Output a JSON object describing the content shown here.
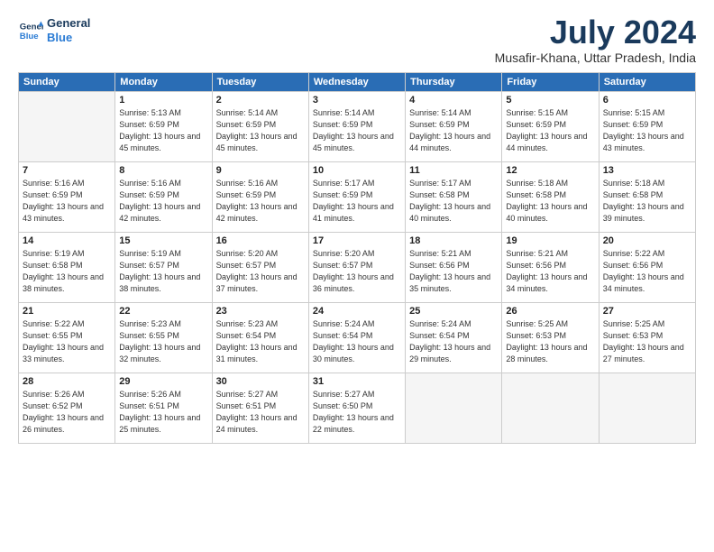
{
  "header": {
    "logo_line1": "General",
    "logo_line2": "Blue",
    "month_year": "July 2024",
    "location": "Musafir-Khana, Uttar Pradesh, India"
  },
  "weekdays": [
    "Sunday",
    "Monday",
    "Tuesday",
    "Wednesday",
    "Thursday",
    "Friday",
    "Saturday"
  ],
  "weeks": [
    [
      {
        "day": "",
        "empty": true
      },
      {
        "day": "1",
        "sunrise": "5:13 AM",
        "sunset": "6:59 PM",
        "daylight": "13 hours and 45 minutes."
      },
      {
        "day": "2",
        "sunrise": "5:14 AM",
        "sunset": "6:59 PM",
        "daylight": "13 hours and 45 minutes."
      },
      {
        "day": "3",
        "sunrise": "5:14 AM",
        "sunset": "6:59 PM",
        "daylight": "13 hours and 45 minutes."
      },
      {
        "day": "4",
        "sunrise": "5:14 AM",
        "sunset": "6:59 PM",
        "daylight": "13 hours and 44 minutes."
      },
      {
        "day": "5",
        "sunrise": "5:15 AM",
        "sunset": "6:59 PM",
        "daylight": "13 hours and 44 minutes."
      },
      {
        "day": "6",
        "sunrise": "5:15 AM",
        "sunset": "6:59 PM",
        "daylight": "13 hours and 43 minutes."
      }
    ],
    [
      {
        "day": "7",
        "sunrise": "5:16 AM",
        "sunset": "6:59 PM",
        "daylight": "13 hours and 43 minutes."
      },
      {
        "day": "8",
        "sunrise": "5:16 AM",
        "sunset": "6:59 PM",
        "daylight": "13 hours and 42 minutes."
      },
      {
        "day": "9",
        "sunrise": "5:16 AM",
        "sunset": "6:59 PM",
        "daylight": "13 hours and 42 minutes."
      },
      {
        "day": "10",
        "sunrise": "5:17 AM",
        "sunset": "6:59 PM",
        "daylight": "13 hours and 41 minutes."
      },
      {
        "day": "11",
        "sunrise": "5:17 AM",
        "sunset": "6:58 PM",
        "daylight": "13 hours and 40 minutes."
      },
      {
        "day": "12",
        "sunrise": "5:18 AM",
        "sunset": "6:58 PM",
        "daylight": "13 hours and 40 minutes."
      },
      {
        "day": "13",
        "sunrise": "5:18 AM",
        "sunset": "6:58 PM",
        "daylight": "13 hours and 39 minutes."
      }
    ],
    [
      {
        "day": "14",
        "sunrise": "5:19 AM",
        "sunset": "6:58 PM",
        "daylight": "13 hours and 38 minutes."
      },
      {
        "day": "15",
        "sunrise": "5:19 AM",
        "sunset": "6:57 PM",
        "daylight": "13 hours and 38 minutes."
      },
      {
        "day": "16",
        "sunrise": "5:20 AM",
        "sunset": "6:57 PM",
        "daylight": "13 hours and 37 minutes."
      },
      {
        "day": "17",
        "sunrise": "5:20 AM",
        "sunset": "6:57 PM",
        "daylight": "13 hours and 36 minutes."
      },
      {
        "day": "18",
        "sunrise": "5:21 AM",
        "sunset": "6:56 PM",
        "daylight": "13 hours and 35 minutes."
      },
      {
        "day": "19",
        "sunrise": "5:21 AM",
        "sunset": "6:56 PM",
        "daylight": "13 hours and 34 minutes."
      },
      {
        "day": "20",
        "sunrise": "5:22 AM",
        "sunset": "6:56 PM",
        "daylight": "13 hours and 34 minutes."
      }
    ],
    [
      {
        "day": "21",
        "sunrise": "5:22 AM",
        "sunset": "6:55 PM",
        "daylight": "13 hours and 33 minutes."
      },
      {
        "day": "22",
        "sunrise": "5:23 AM",
        "sunset": "6:55 PM",
        "daylight": "13 hours and 32 minutes."
      },
      {
        "day": "23",
        "sunrise": "5:23 AM",
        "sunset": "6:54 PM",
        "daylight": "13 hours and 31 minutes."
      },
      {
        "day": "24",
        "sunrise": "5:24 AM",
        "sunset": "6:54 PM",
        "daylight": "13 hours and 30 minutes."
      },
      {
        "day": "25",
        "sunrise": "5:24 AM",
        "sunset": "6:54 PM",
        "daylight": "13 hours and 29 minutes."
      },
      {
        "day": "26",
        "sunrise": "5:25 AM",
        "sunset": "6:53 PM",
        "daylight": "13 hours and 28 minutes."
      },
      {
        "day": "27",
        "sunrise": "5:25 AM",
        "sunset": "6:53 PM",
        "daylight": "13 hours and 27 minutes."
      }
    ],
    [
      {
        "day": "28",
        "sunrise": "5:26 AM",
        "sunset": "6:52 PM",
        "daylight": "13 hours and 26 minutes."
      },
      {
        "day": "29",
        "sunrise": "5:26 AM",
        "sunset": "6:51 PM",
        "daylight": "13 hours and 25 minutes."
      },
      {
        "day": "30",
        "sunrise": "5:27 AM",
        "sunset": "6:51 PM",
        "daylight": "13 hours and 24 minutes."
      },
      {
        "day": "31",
        "sunrise": "5:27 AM",
        "sunset": "6:50 PM",
        "daylight": "13 hours and 22 minutes."
      },
      {
        "day": "",
        "empty": true
      },
      {
        "day": "",
        "empty": true
      },
      {
        "day": "",
        "empty": true
      }
    ]
  ]
}
